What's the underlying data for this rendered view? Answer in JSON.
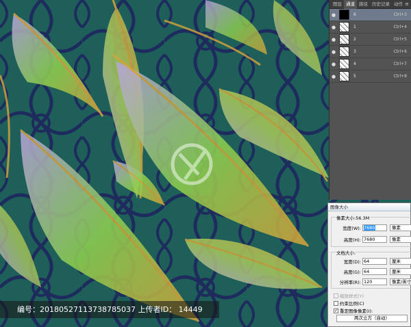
{
  "panel": {
    "tabs": [
      {
        "label": "图层"
      },
      {
        "label": "通道"
      },
      {
        "label": "路径"
      },
      {
        "label": "历史记录"
      },
      {
        "label": "动作"
      }
    ],
    "channels": [
      {
        "name": "6",
        "shortcut": "Ctrl+3",
        "thumb": "black",
        "selected": true
      },
      {
        "name": "1",
        "shortcut": "Ctrl+4",
        "thumb": "pattern",
        "selected": false
      },
      {
        "name": "2",
        "shortcut": "Ctrl+5",
        "thumb": "pattern",
        "selected": false
      },
      {
        "name": "3",
        "shortcut": "Ctrl+6",
        "thumb": "pattern",
        "selected": false
      },
      {
        "name": "4",
        "shortcut": "Ctrl+7",
        "thumb": "pattern",
        "selected": false
      },
      {
        "name": "5",
        "shortcut": "Ctrl+8",
        "thumb": "pattern",
        "selected": false
      }
    ]
  },
  "dialog": {
    "title": "图像大小",
    "pixel_dimensions": {
      "label": "像素大小:56.3M",
      "width_label": "宽度(W):",
      "width_value": "7680",
      "width_unit": "像素",
      "height_label": "高度(H):",
      "height_value": "7680",
      "height_unit": "像素"
    },
    "document_size": {
      "label": "文档大小:",
      "width_label": "宽度(D):",
      "width_value": "64",
      "width_unit": "厘米",
      "height_label": "高度(G):",
      "height_value": "64",
      "height_unit": "厘米",
      "resolution_label": "分辨率(R):",
      "resolution_value": "120",
      "resolution_unit": "像素/英寸"
    },
    "scale_styles_label": "缩放样式(Y)",
    "constrain_label": "约束比例(C)",
    "resample_label": "重定图像像素(I):",
    "resample_method": "两次立方（自动）"
  },
  "watermark": {
    "text": "编号：20180527113738785037 上传者ID： 14449"
  },
  "colors": {
    "background": "#1f5f5a",
    "feather_green": "#8fd14f",
    "feather_gold": "#d8a43a",
    "feather_lavender": "#b9a4e0",
    "pattern_navy": "#1d2c5c"
  }
}
